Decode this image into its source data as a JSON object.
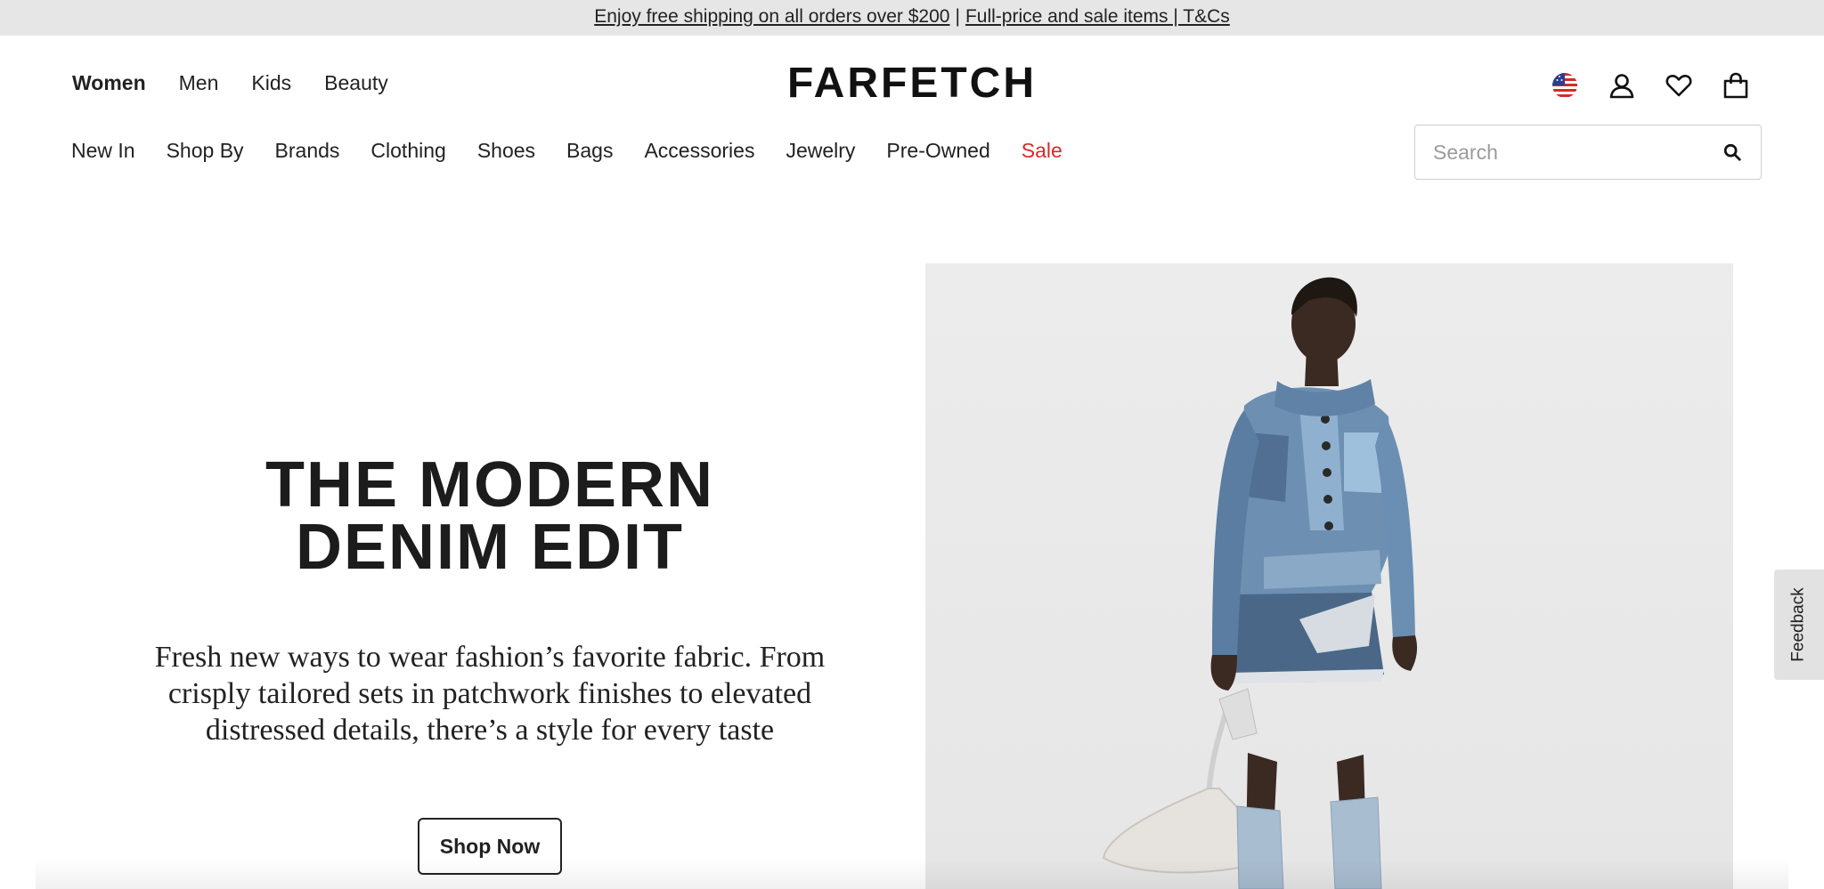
{
  "banner": {
    "link1": "Enjoy free shipping on all orders over $200",
    "separator": "|",
    "link2": "Full-price and sale items | T&Cs"
  },
  "gender_nav": [
    {
      "label": "Women",
      "active": true
    },
    {
      "label": "Men"
    },
    {
      "label": "Kids"
    },
    {
      "label": "Beauty"
    }
  ],
  "logo": "FARFETCH",
  "header_icons": [
    "us-flag-icon",
    "account-icon",
    "heart-icon",
    "shopping-bag-icon"
  ],
  "category_nav": [
    {
      "label": "New In"
    },
    {
      "label": "Shop By"
    },
    {
      "label": "Brands"
    },
    {
      "label": "Clothing"
    },
    {
      "label": "Shoes"
    },
    {
      "label": "Bags"
    },
    {
      "label": "Accessories"
    },
    {
      "label": "Jewelry"
    },
    {
      "label": "Pre-Owned"
    },
    {
      "label": "Sale",
      "color": "#d42a2a"
    }
  ],
  "search": {
    "placeholder": "Search",
    "value": "",
    "icon": "search-icon"
  },
  "hero": {
    "title_line1": "THE MODERN",
    "title_line2": "DENIM EDIT",
    "subtitle": "Fresh new ways to wear fashion’s favorite fabric. From crisply tailored sets in patchwork finishes to elevated distressed details, there’s a style for every taste",
    "cta_label": "Shop Now"
  },
  "feedback_label": "Feedback",
  "colors": {
    "banner_bg": "#e6e6e6",
    "sale": "#d42a2a",
    "text": "#222222"
  }
}
